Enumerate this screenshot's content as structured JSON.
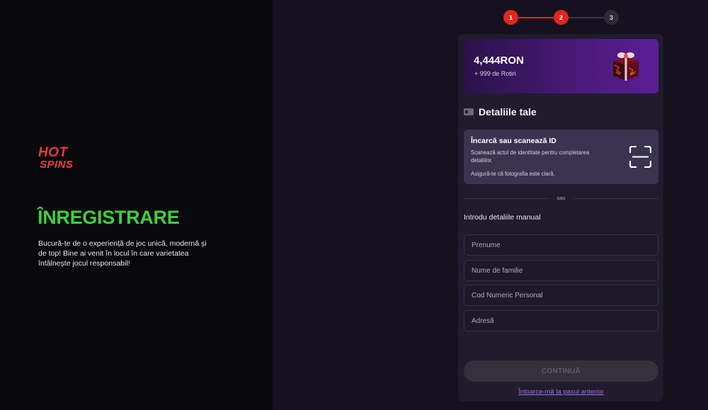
{
  "brand": {
    "logo_line1": "HOT",
    "logo_line2": "SPINS",
    "logo_color": "#ee3b3b"
  },
  "left": {
    "title": "ÎNREGISTRARE",
    "title_color": "#3ecf3e",
    "description": "Bucură-te de o experiență de joc unică, modernă și de top! Bine ai venit în locul în care varietatea întâlnește jocul responsabil!"
  },
  "stepper": {
    "steps": [
      {
        "label": "1",
        "state": "active"
      },
      {
        "label": "2",
        "state": "active"
      },
      {
        "label": "3",
        "state": "inactive"
      }
    ],
    "accent_color": "#e2261c"
  },
  "bonus": {
    "amount": "4,444RON",
    "spins": "+ 999 de Rotiri",
    "icon": "gift-box-icon"
  },
  "section": {
    "title": "Detaliile tale",
    "icon": "id-card-icon"
  },
  "scan": {
    "title": "Încarcă sau scanează ID",
    "description": "Scanează actul de identitate pentru completarea detaliilor.",
    "note": "Asigură-te că fotografia este clară.",
    "icon": "scan-frame-icon"
  },
  "divider": {
    "text": "sau"
  },
  "manual": {
    "label": "Introdu detaliile manual"
  },
  "fields": {
    "first_name": {
      "placeholder": "Prenume",
      "value": ""
    },
    "last_name": {
      "placeholder": "Nume de familie",
      "value": ""
    },
    "cnp": {
      "placeholder": "Cod Numeric Personal",
      "value": ""
    },
    "address": {
      "placeholder": "Adresă",
      "value": ""
    }
  },
  "actions": {
    "continue_label": "CONTINUĂ",
    "back_label": "Întoarce-mă la pasul anterior",
    "link_color": "#a26be0"
  }
}
